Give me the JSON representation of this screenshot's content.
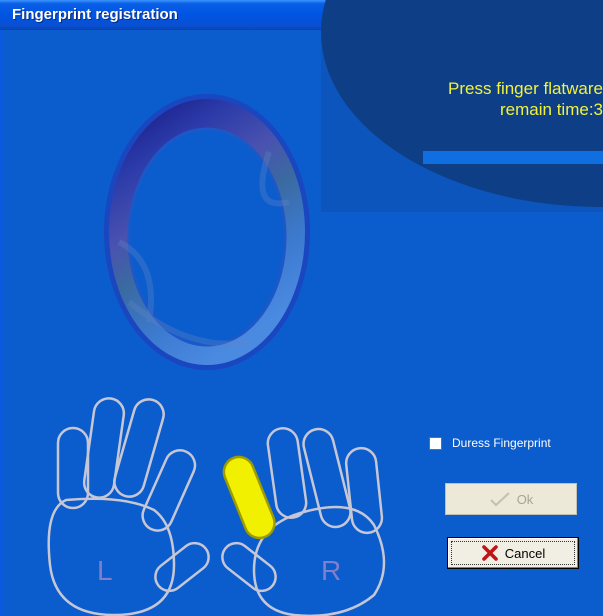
{
  "title": "Fingerprint registration",
  "prompt": {
    "line1": "Press finger flatware",
    "line2": "remain time:3"
  },
  "hand_labels": {
    "left": "L",
    "right": "R"
  },
  "duress_checkbox": {
    "label": "Duress Fingerprint",
    "checked": false
  },
  "buttons": {
    "ok": "Ok",
    "cancel": "Cancel",
    "ok_enabled": false
  },
  "selected_finger": "right-index",
  "colors": {
    "background": "#0b5ccc",
    "prompt_text": "#f2f23c",
    "selected_finger": "#f0f000",
    "outline": "#c6c7d6"
  }
}
